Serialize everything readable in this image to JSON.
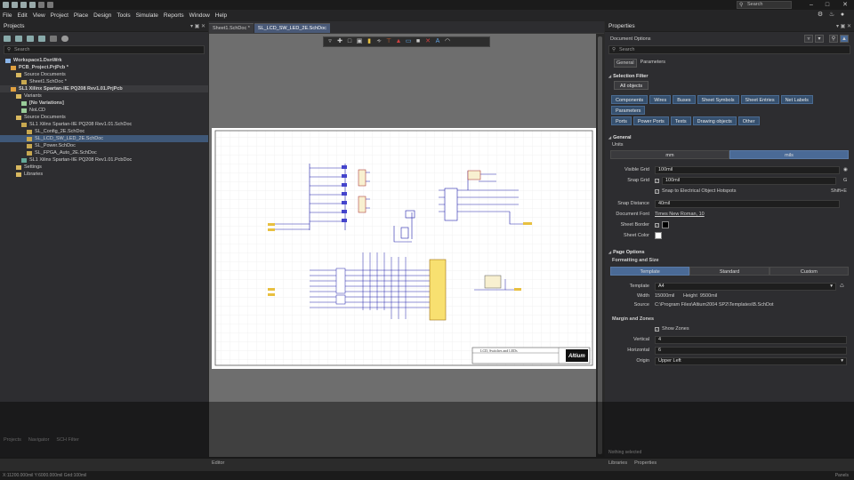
{
  "titlebar": {
    "search_placeholder": "Search"
  },
  "menu": [
    "File",
    "Edit",
    "View",
    "Project",
    "Place",
    "Design",
    "Tools",
    "Simulate",
    "Reports",
    "Window",
    "Help"
  ],
  "projects": {
    "title": "Projects",
    "search_placeholder": "Search",
    "tree": [
      {
        "label": "Workspace1.DsnWrk",
        "indent": 1,
        "bold": true,
        "color": "#8ab4e8"
      },
      {
        "label": "PCB_Project.PrjPcb *",
        "indent": 2,
        "bold": true,
        "color": "#e0a040"
      },
      {
        "label": "Source Documents",
        "indent": 3,
        "bold": false,
        "color": "#d8b860"
      },
      {
        "label": "Sheet1.SchDoc *",
        "indent": 4,
        "bold": false,
        "color": "#c8a850"
      },
      {
        "label": "SL1 Xilinx Spartan-IIE PQ208 Rev1.01.PrjPcb",
        "indent": 2,
        "bold": true,
        "color": "#e0a040",
        "sel": false,
        "hl": true
      },
      {
        "label": "Variants",
        "indent": 3,
        "bold": false,
        "color": "#d8b860"
      },
      {
        "label": "[No Variations]",
        "indent": 4,
        "bold": true,
        "color": "#9c9"
      },
      {
        "label": "NoLCD",
        "indent": 4,
        "bold": false,
        "color": "#9c9"
      },
      {
        "label": "Source Documents",
        "indent": 3,
        "bold": false,
        "color": "#d8b860"
      },
      {
        "label": "SL1 Xilinx Spartan-IIE PQ208 Rev1.01.SchDoc",
        "indent": 4,
        "bold": false,
        "color": "#c8a850"
      },
      {
        "label": "SL_Config_2E.SchDoc",
        "indent": 5,
        "bold": false,
        "color": "#c8a850"
      },
      {
        "label": "SL_LCD_SW_LED_2E.SchDoc",
        "indent": 5,
        "bold": false,
        "color": "#c8a850",
        "sel": true
      },
      {
        "label": "SL_Power.SchDoc",
        "indent": 5,
        "bold": false,
        "color": "#c8a850"
      },
      {
        "label": "SL_FPGA_Auto_2E.SchDoc",
        "indent": 5,
        "bold": false,
        "color": "#c8a850"
      },
      {
        "label": "SL1 Xilinx Spartan-IIE PQ208 Rev1.01.PcbDoc",
        "indent": 4,
        "bold": false,
        "color": "#6a9"
      },
      {
        "label": "Settings",
        "indent": 3,
        "bold": false,
        "color": "#d8b860"
      },
      {
        "label": "Libraries",
        "indent": 3,
        "bold": false,
        "color": "#d8b860"
      }
    ],
    "bottom_tabs": [
      "Projects",
      "Navigator",
      "SCH Filter"
    ]
  },
  "editor": {
    "tabs": [
      {
        "label": "Sheet1.SchDoc *",
        "active": false
      },
      {
        "label": "SL_LCD_SW_LED_2E.SchDoc",
        "active": true
      }
    ],
    "bottom_tab": "Editor",
    "title_block_text": "LCD, Switches and LEDs",
    "logo_text": "Altium"
  },
  "properties": {
    "title": "Properties",
    "subtitle": "Document Options",
    "search_placeholder": "Search",
    "tabs": [
      "General",
      "Parameters"
    ],
    "selection_filter": "Selection Filter",
    "all_objects": "All objects",
    "filters": [
      "Components",
      "Wires",
      "Buses",
      "Sheet Symbols",
      "Sheet Entries",
      "Net Labels",
      "Parameters",
      "Ports",
      "Power Ports",
      "Texts",
      "Drawing objects",
      "Other"
    ],
    "general": "General",
    "units_label": "Units",
    "units": [
      "mm",
      "mils"
    ],
    "visible_grid_label": "Visible Grid",
    "visible_grid": "100mil",
    "snap_grid_label": "Snap Grid",
    "snap_grid": "100mil",
    "snap_grid_key": "G",
    "snap_hotspots": "Snap to Electrical Object Hotspots",
    "snap_hotspots_key": "Shift+E",
    "snap_distance_label": "Snap Distance",
    "snap_distance": "40mil",
    "doc_font_label": "Document Font",
    "doc_font": "Times New Roman, 10",
    "sheet_border_label": "Sheet Border",
    "sheet_color_label": "Sheet Color",
    "page_options": "Page Options",
    "formatting": "Formatting and Size",
    "format_tabs": [
      "Template",
      "Standard",
      "Custom"
    ],
    "template_label": "Template",
    "template": "A4",
    "width_label": "Width",
    "width": "15000mil",
    "height_label": "Height",
    "height": "9500mil",
    "source_label": "Source",
    "source": "C:\\Program Files\\Altium2004 SP2\\Templates\\B.SchDot",
    "margin": "Margin and Zones",
    "show_zones": "Show Zones",
    "vertical_label": "Vertical",
    "vertical": "4",
    "horizontal_label": "Horizontal",
    "horizontal": "6",
    "origin_label": "Origin",
    "origin": "Upper Left",
    "nothing_selected": "Nothing selected",
    "bottom_tabs": [
      "Libraries",
      "Properties"
    ]
  },
  "status": {
    "coords": "X:11200.000mil Y:6000.000mil  Grid:100mil",
    "right": "Panels"
  }
}
